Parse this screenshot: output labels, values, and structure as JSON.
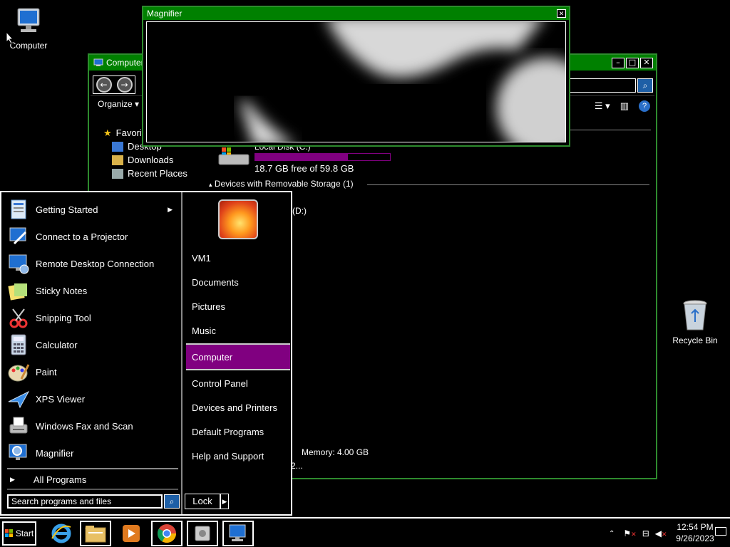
{
  "desktop": {
    "icons": [
      {
        "label": "Computer",
        "icon": "computer-icon"
      },
      {
        "label": "Recycle Bin",
        "icon": "recycle-bin-icon"
      }
    ]
  },
  "explorer": {
    "title": "Computer",
    "toolbar": {
      "organize": "Organize"
    },
    "sidebar": {
      "favorites": "Favorites",
      "desktop": "Desktop",
      "downloads": "Downloads",
      "recent": "Recent Places"
    },
    "drive_c": {
      "label": "Local Disk (C:)",
      "free_text": "18.7 GB free of 59.8 GB",
      "used_fraction": 0.69
    },
    "removable_header": "Devices with Removable Storage (1)",
    "drive_d": {
      "label": "(D:)"
    },
    "memory": "Memory: 4.00 GB",
    "processor_partial": "2..."
  },
  "magnifier": {
    "title": "Magnifier"
  },
  "start_menu": {
    "programs": [
      {
        "label": "Getting Started",
        "icon": "getting-started-icon",
        "has_submenu": true
      },
      {
        "label": "Connect to a Projector",
        "icon": "projector-icon"
      },
      {
        "label": "Remote Desktop Connection",
        "icon": "remote-desktop-icon"
      },
      {
        "label": "Sticky Notes",
        "icon": "sticky-notes-icon"
      },
      {
        "label": "Snipping Tool",
        "icon": "snipping-tool-icon"
      },
      {
        "label": "Calculator",
        "icon": "calculator-icon"
      },
      {
        "label": "Paint",
        "icon": "paint-icon"
      },
      {
        "label": "XPS Viewer",
        "icon": "xps-viewer-icon"
      },
      {
        "label": "Windows Fax and Scan",
        "icon": "fax-scan-icon"
      },
      {
        "label": "Magnifier",
        "icon": "magnifier-icon"
      }
    ],
    "all_programs": "All Programs",
    "search_placeholder": "Search programs and files",
    "right_items": [
      {
        "label": "VM1"
      },
      {
        "label": "Documents"
      },
      {
        "label": "Pictures"
      },
      {
        "label": "Music"
      },
      {
        "label": "Computer",
        "selected": true
      },
      {
        "label": "Control Panel"
      },
      {
        "label": "Devices and Printers"
      },
      {
        "label": "Default Programs"
      },
      {
        "label": "Help and Support"
      }
    ],
    "lock_label": "Lock"
  },
  "taskbar": {
    "start_label": "Start",
    "pinned": [
      "internet-explorer-icon",
      "file-explorer-icon",
      "media-player-icon",
      "chrome-icon",
      "disk-icon",
      "computer-icon"
    ],
    "clock_time": "12:54 PM",
    "clock_date": "9/26/2023"
  },
  "colors": {
    "title_green": "#008000",
    "accent_purple": "#800080"
  }
}
